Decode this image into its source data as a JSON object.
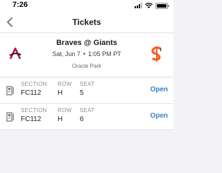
{
  "status_bar": {
    "time": "7:26",
    "icons": [
      "cellular-signal-icon",
      "wifi-icon",
      "battery-icon"
    ]
  },
  "nav": {
    "title": "Tickets",
    "back_icon": "chevron-left-icon"
  },
  "event": {
    "title": "Braves @ Giants",
    "date": "Sat, Jun 7",
    "separator": "•",
    "time": "1:05 PM PT",
    "venue": "Oracle Park",
    "away_logo": "braves-logo-icon",
    "home_logo": "giants-logo-icon"
  },
  "tickets": {
    "labels": {
      "section": "SECTION",
      "row": "ROW",
      "seat": "SEAT"
    },
    "items": [
      {
        "section": "FC112",
        "row": "H",
        "seat": "5",
        "action": "Open"
      },
      {
        "section": "FC112",
        "row": "H",
        "seat": "6",
        "action": "Open"
      }
    ]
  },
  "colors": {
    "background": "#f2f2f7",
    "accent": "#2f80c8",
    "braves": "#c8102e",
    "giants": "#fd5a1e"
  }
}
